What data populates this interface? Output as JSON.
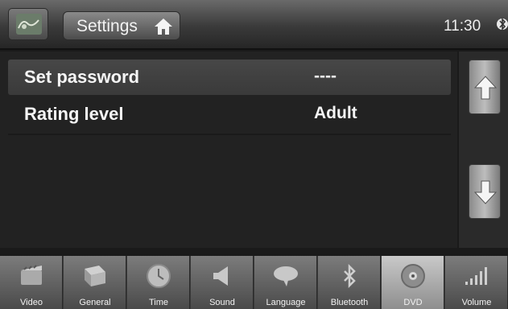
{
  "header": {
    "title": "Settings",
    "time": "11:30"
  },
  "rows": [
    {
      "label": "Set password",
      "value": "----"
    },
    {
      "label": "Rating level",
      "value": "Adult"
    }
  ],
  "tabs": [
    {
      "label": "Video",
      "icon": "video-icon"
    },
    {
      "label": "General",
      "icon": "general-icon"
    },
    {
      "label": "Time",
      "icon": "clock-icon"
    },
    {
      "label": "Sound",
      "icon": "speaker-icon"
    },
    {
      "label": "Language",
      "icon": "speech-bubble-icon"
    },
    {
      "label": "Bluetooth",
      "icon": "bluetooth-icon"
    },
    {
      "label": "DVD",
      "icon": "disc-icon",
      "active": true
    },
    {
      "label": "Volume",
      "icon": "volume-icon"
    }
  ]
}
